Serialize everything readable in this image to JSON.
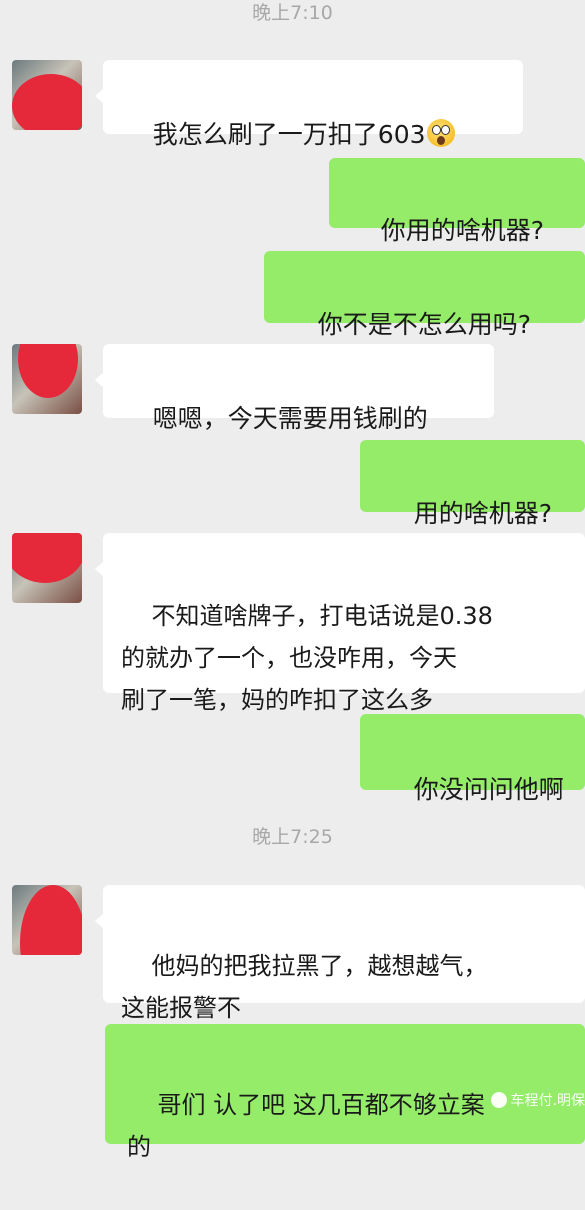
{
  "chat": {
    "timestamps": [
      "晚上7:10",
      "晚上7:25"
    ],
    "messages": [
      {
        "side": "left",
        "text": "我怎么刷了一万扣了603",
        "emoji": "astonished-emoji"
      },
      {
        "side": "right",
        "text": "你用的啥机器?"
      },
      {
        "side": "right",
        "text": "你不是不怎么用吗?"
      },
      {
        "side": "left",
        "text": "嗯嗯，今天需要用钱刷的"
      },
      {
        "side": "right",
        "text": "用的啥机器?"
      },
      {
        "side": "left",
        "text": "不知道啥牌子，打电话说是0.38\n的就办了一个，也没咋用，今天\n刷了一笔，妈的咋扣了这么多"
      },
      {
        "side": "right",
        "text": "你没问问他啊"
      },
      {
        "side": "left",
        "text": "他妈的把我拉黑了，越想越气，\n这能报警不"
      },
      {
        "side": "right",
        "text": "哥们 认了吧 这几百都不够立案\n的"
      }
    ]
  },
  "watermark": {
    "text": "车程付.明保"
  },
  "colors": {
    "background": "#ededed",
    "incoming_bubble": "#ffffff",
    "outgoing_bubble": "#95ec69",
    "redaction": "#e5283a",
    "timestamp": "#a8a8a8"
  }
}
